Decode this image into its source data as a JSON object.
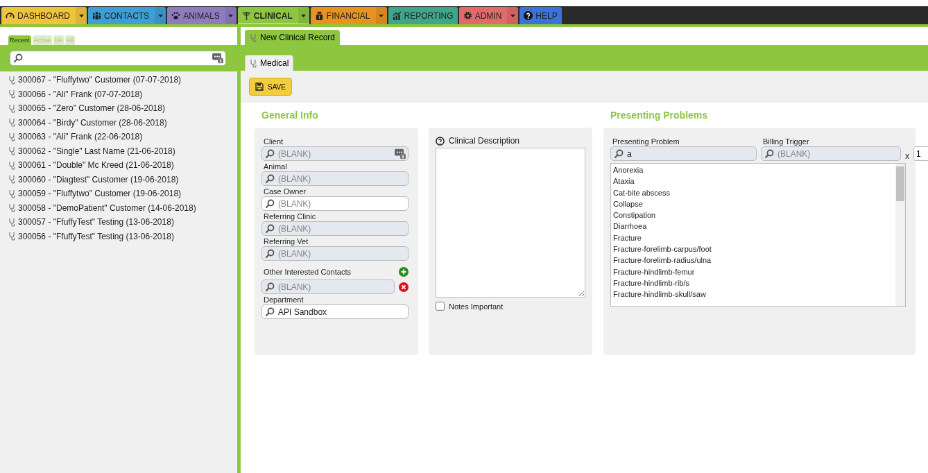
{
  "nav": [
    {
      "label": "DASHBOARD",
      "color": "#f0c33c",
      "menu": true,
      "selected": false
    },
    {
      "label": "CONTACTS",
      "color": "#3d9fd6",
      "menu": true,
      "selected": false
    },
    {
      "label": "ANIMALS",
      "color": "#8f7cbf",
      "menu": true,
      "selected": false
    },
    {
      "label": "CLINICAL",
      "color": "#8dc63f",
      "menu": true,
      "selected": true
    },
    {
      "label": "FINANCIAL",
      "color": "#e8921f",
      "menu": true,
      "selected": false
    },
    {
      "label": "REPORTING",
      "color": "#3fa68c",
      "menu": false,
      "selected": false
    },
    {
      "label": "ADMIN",
      "color": "#e26a6a",
      "menu": true,
      "selected": false
    },
    {
      "label": "HELP",
      "color": "#3b72d9",
      "menu": false,
      "selected": false
    }
  ],
  "sidebar": {
    "filters": [
      {
        "label": "Recent",
        "selected": true
      },
      {
        "label": "Active",
        "selected": false
      },
      {
        "label": "I/A",
        "selected": false
      },
      {
        "label": "All",
        "selected": false
      }
    ],
    "items": [
      "300067 - \"Fluffytwo\" Customer (07-07-2018)",
      "300066 - \"Ali\" Frank (07-07-2018)",
      "300065 - \"Zero\" Customer (28-06-2018)",
      "300064 - \"Birdy\" Customer (28-06-2018)",
      "300063 - \"Ali\" Frank (22-06-2018)",
      "300062 - \"Single\" Last Name (21-06-2018)",
      "300061 - \"Double\" Mc Kreed (21-06-2018)",
      "300060 - \"Diagtest\" Customer (19-06-2018)",
      "300059 - \"Fluffytwo\" Customer (19-06-2018)",
      "300058 - \"DemoPatient\" Customer (14-06-2018)",
      "300057 - \"FfuffyTest\" Testing (13-06-2018)",
      "300056 - \"FfuffyTest\" Testing (13-06-2018)"
    ]
  },
  "record_tab": "New Clinical Record",
  "sub_tab": "Medical",
  "save": "SAVE",
  "general_info": {
    "title": "General Info",
    "fields": [
      {
        "label": "Client",
        "placeholder": "(BLANK)",
        "readonly": true,
        "lookup": true
      },
      {
        "label": "Animal",
        "placeholder": "(BLANK)",
        "readonly": true,
        "lookup": false
      },
      {
        "label": "Case Owner",
        "placeholder": "(BLANK)",
        "readonly": false,
        "lookup": false
      },
      {
        "label": "Referring Clinic",
        "placeholder": "(BLANK)",
        "readonly": true,
        "lookup": false
      },
      {
        "label": "Referring Vet",
        "placeholder": "(BLANK)",
        "readonly": true,
        "lookup": false
      }
    ],
    "contacts": {
      "label": "Other Interested Contacts",
      "placeholder": "(BLANK)"
    },
    "department": {
      "label": "Department",
      "value": "API Sandbox"
    }
  },
  "clinical_description": {
    "label": "Clinical Description",
    "notes_important": {
      "label": "Notes Important",
      "checked": false
    }
  },
  "presenting_problems": {
    "title": "Presenting Problems",
    "problem_label": "Presenting Problem",
    "problem_value": "a",
    "billing_label": "Billing Trigger",
    "billing_placeholder": "(BLANK)",
    "times": "x",
    "quantity": "1",
    "options": [
      "Anorexia",
      "Ataxia",
      "Cat-bite abscess",
      "Collapse",
      "Constipation",
      "Diarrhoea",
      "Fracture",
      "Fracture-forelimb-carpus/foot",
      "Fracture-forelimb-radius/ulna",
      "Fracture-hindlimb-femur",
      "Fracture-hindlimb-rib/s",
      "Fracture-hindlimb-skull/saw"
    ]
  }
}
